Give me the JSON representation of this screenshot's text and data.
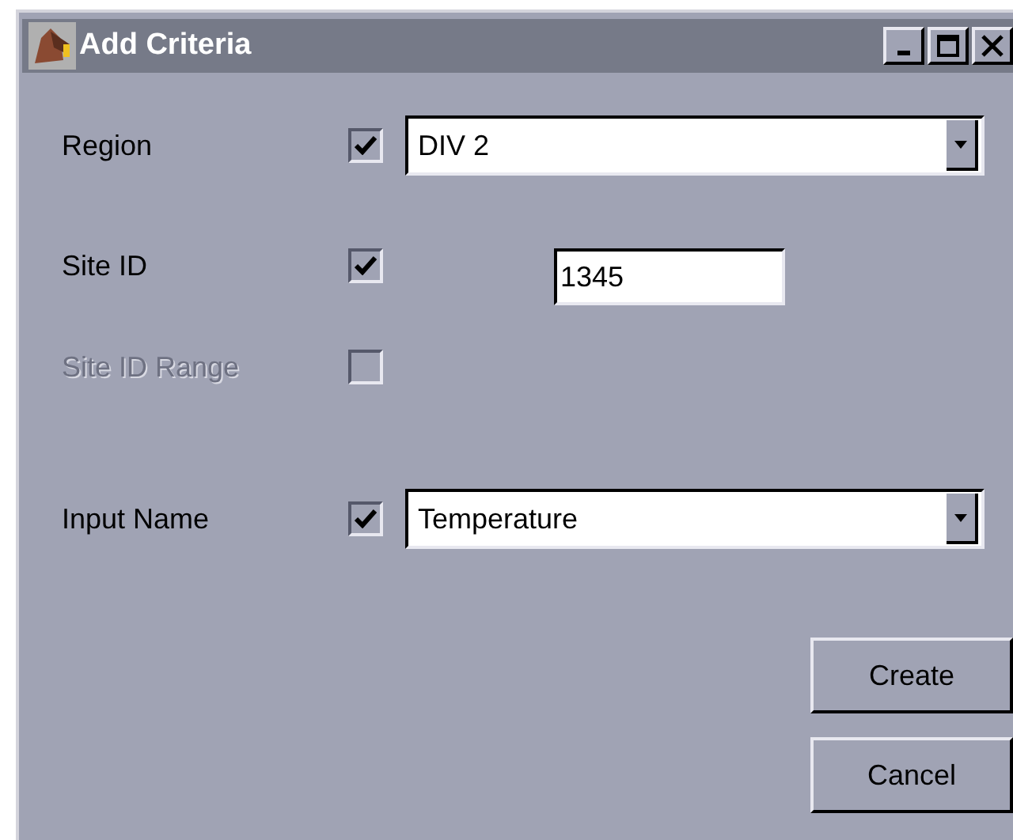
{
  "window": {
    "title": "Add Criteria"
  },
  "fields": [
    {
      "kind": "dropdown",
      "label": "Region",
      "checked": true,
      "disabled": false,
      "value": "DIV 2"
    },
    {
      "kind": "text",
      "label": "Site ID",
      "checked": true,
      "disabled": false,
      "value": "1345"
    },
    {
      "kind": "none",
      "label": "Site ID Range",
      "checked": false,
      "disabled": true
    },
    {
      "kind": "dropdown",
      "label": "Input Name",
      "checked": true,
      "disabled": false,
      "value": "Temperature"
    }
  ],
  "buttons": [
    "Create",
    "Cancel"
  ]
}
